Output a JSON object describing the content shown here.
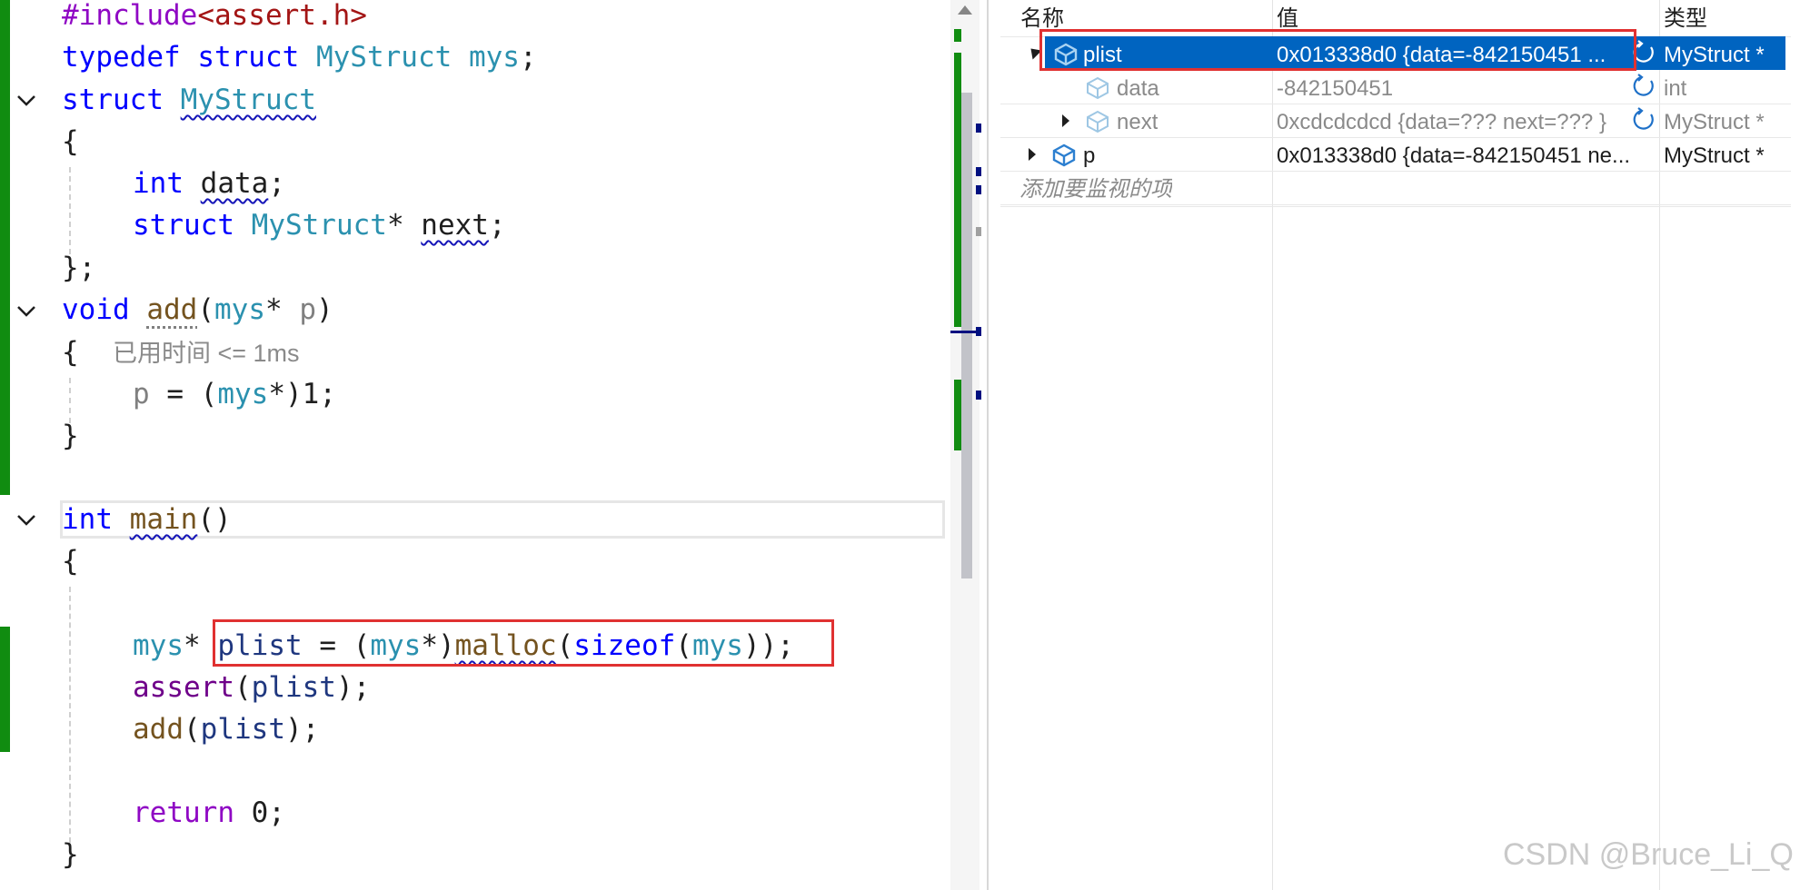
{
  "editor": {
    "lines": {
      "l1": {
        "a": "#include",
        "b": "<assert.h>"
      },
      "l2": {
        "a": "typedef",
        "b": " struct ",
        "c": "MyStruct",
        "d": " ",
        "e": "mys",
        "f": ";"
      },
      "l3": {
        "a": "struct",
        "b": " ",
        "c": "MyStruct"
      },
      "l4": {
        "a": "{"
      },
      "l5": {
        "a": "int",
        "b": " ",
        "c": "data",
        "d": ";"
      },
      "l6": {
        "a": "struct",
        "b": " ",
        "c": "MyStruct",
        "d": "* ",
        "e": "next",
        "f": ";"
      },
      "l7": {
        "a": "};"
      },
      "l8": {
        "a": "void",
        "b": " ",
        "c": "add",
        "d": "(",
        "e": "mys",
        "f": "* ",
        "g": "p",
        "h": ")"
      },
      "l9": {
        "a": "{",
        "hint": "已用时间 <= 1ms"
      },
      "l10": {
        "a": "p",
        "b": " = (",
        "c": "mys",
        "d": "*)1;"
      },
      "l11": {
        "a": "}"
      },
      "l12": {
        "a": "int",
        "b": " ",
        "c": "main",
        "d": "()"
      },
      "l13": {
        "a": "{"
      },
      "l14": {
        "a": "mys",
        "b": "* ",
        "c": "plist",
        "d": " = (",
        "e": "mys",
        "f": "*)",
        "g": "malloc",
        "h": "(",
        "i": "sizeof",
        "j": "(",
        "k": "mys",
        "l": "));"
      },
      "l15": {
        "a": "assert",
        "b": "(",
        "c": "plist",
        "d": ");"
      },
      "l16": {
        "a": "add",
        "b": "(",
        "c": "plist",
        "d": ");"
      },
      "l17": {
        "a": "return",
        "b": " 0;"
      },
      "l18": {
        "a": "}"
      }
    }
  },
  "watch": {
    "headers": {
      "name": "名称",
      "value": "值",
      "type": "类型"
    },
    "rows": [
      {
        "name": "plist",
        "value": "0x013338d0 {data=-842150451 ...",
        "type": "MyStruct *"
      },
      {
        "name": "data",
        "value": "-842150451",
        "type": "int"
      },
      {
        "name": "next",
        "value": "0xcdcdcdcd {data=??? next=??? }",
        "type": "MyStruct *"
      },
      {
        "name": "p",
        "value": "0x013338d0 {data=-842150451 ne...",
        "type": "MyStruct *"
      }
    ],
    "add_placeholder": "添加要监视的项"
  },
  "watermark": "CSDN @Bruce_Li_Q",
  "colors": {
    "keyword": "#0000ff",
    "type": "#2b91af",
    "function": "#74531f",
    "selection": "#0064c0",
    "highlight_box": "#e03131",
    "change_bar": "#108c10"
  }
}
